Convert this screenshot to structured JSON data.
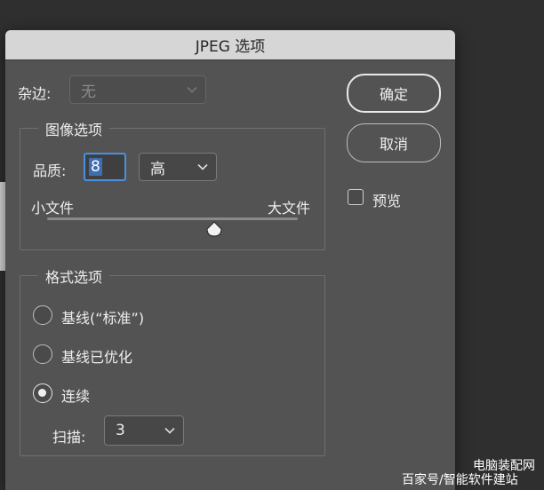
{
  "dialog": {
    "title": "JPEG 选项"
  },
  "matte": {
    "label": "杂边:",
    "value": "无"
  },
  "image_options": {
    "title": "图像选项",
    "quality_label": "品质:",
    "quality_value": "8",
    "quality_level": "高",
    "small_file_label": "小文件",
    "large_file_label": "大文件",
    "slider_value": 8,
    "slider_max": 12
  },
  "format_options": {
    "title": "格式选项",
    "options": [
      {
        "label": "基线(“标准”)",
        "selected": false
      },
      {
        "label": "基线已优化",
        "selected": false
      },
      {
        "label": "连续",
        "selected": true
      }
    ],
    "scan_label": "扫描:",
    "scan_value": "3"
  },
  "buttons": {
    "ok": "确定",
    "cancel": "取消"
  },
  "preview": {
    "label": "预览",
    "checked": false
  },
  "watermark": {
    "top": "电脑装配网",
    "bottom": "百家号/智能软件建站"
  }
}
